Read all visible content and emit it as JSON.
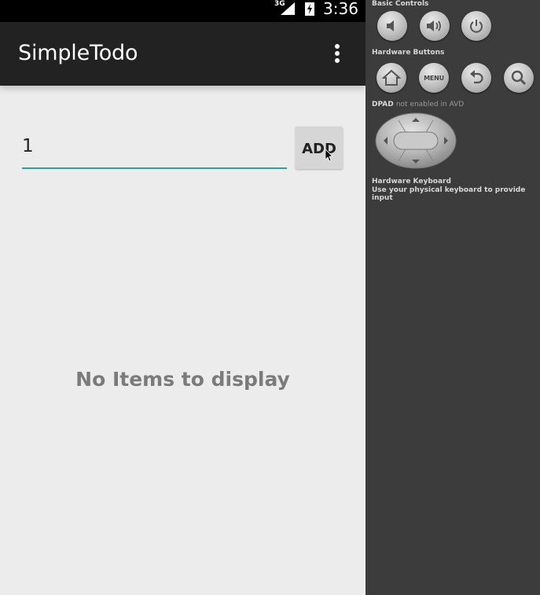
{
  "status_bar": {
    "network": "3G",
    "time": "3:36",
    "icons": [
      "signal-icon",
      "battery-charging-icon"
    ]
  },
  "action_bar": {
    "title": "SimpleTodo",
    "overflow_icon": "more-vert-icon"
  },
  "new_item": {
    "value": "1",
    "add_label": "ADD"
  },
  "empty_state": {
    "text": "No Items to display"
  },
  "emulator_panel": {
    "basic_controls_title": "Basic Controls",
    "basic_controls": [
      "volume-down-icon",
      "volume-up-icon",
      "power-icon"
    ],
    "hardware_buttons_title": "Hardware Buttons",
    "hardware_buttons": [
      "home-icon",
      "menu-button",
      "back-icon",
      "search-icon"
    ],
    "menu_label": "MENU",
    "dpad_title": "DPAD",
    "dpad_note": "not enabled in AVD",
    "keyboard_title": "Hardware Keyboard",
    "keyboard_note": "Use your physical keyboard to provide input"
  },
  "colors": {
    "action_bar": "#222222",
    "screen_background": "#ececec",
    "accent_underline": "#26a69a",
    "empty_text": "#7b7b7b",
    "panel_background": "#3c3c3c"
  }
}
